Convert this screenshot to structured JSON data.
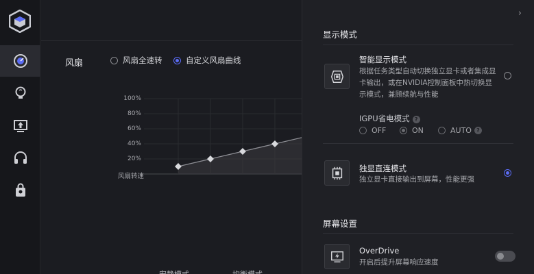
{
  "sidebar": {
    "items": [
      {
        "name": "gauge-icon"
      },
      {
        "name": "bulb-icon"
      },
      {
        "name": "upload-monitor-icon"
      },
      {
        "name": "headset-icon"
      },
      {
        "name": "bag-icon"
      }
    ]
  },
  "fan": {
    "title": "风扇",
    "option_full": "风扇全速转",
    "option_custom": "自定义风扇曲线",
    "selected": "custom"
  },
  "chart_data": {
    "type": "line",
    "ylabel": "风扇转速",
    "y_ticks": [
      "100%",
      "80%",
      "60%",
      "40%",
      "20%"
    ],
    "ylim": [
      0,
      100
    ],
    "points": [
      {
        "x": 1,
        "y": 10
      },
      {
        "x": 2,
        "y": 20
      },
      {
        "x": 3,
        "y": 30
      },
      {
        "x": 4,
        "y": 40
      },
      {
        "x": 5,
        "y": 50
      }
    ],
    "line_color": "#d8d9dd",
    "fill_color": "#3a3b40"
  },
  "modes": {
    "quiet": "安静模式",
    "balanced": "均衡模式"
  },
  "panel": {
    "display_mode_title": "显示模式",
    "smart": {
      "title": "智能显示模式",
      "desc": "根据任务类型自动切换独立显卡或者集成显卡输出，或在NVIDIA控制面板中热切换显示模式，兼顾续航与性能"
    },
    "igpu": {
      "title": "IGPU省电模式",
      "off": "OFF",
      "on": "ON",
      "auto": "AUTO"
    },
    "direct": {
      "title": "独显直连模式",
      "desc": "独立显卡直接输出到屏幕，性能更强"
    },
    "screen_title": "屏幕设置",
    "overdrive": {
      "title": "OverDrive",
      "desc": "开启后提升屏幕响应速度"
    }
  },
  "colors": {
    "accent": "#5b6cf5",
    "bg": "#1a1b1f"
  }
}
